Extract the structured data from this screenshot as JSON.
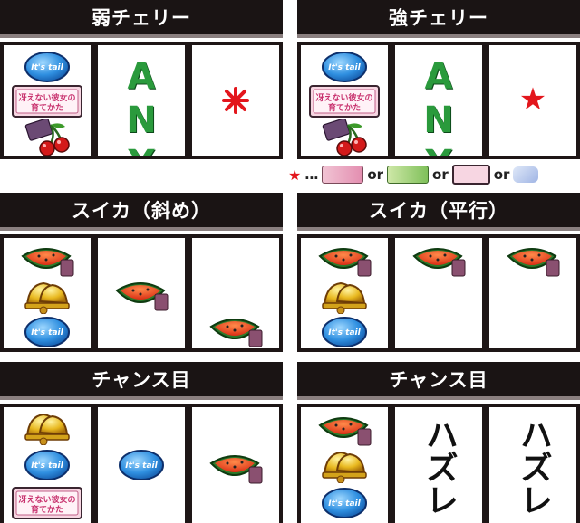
{
  "panels": {
    "weak_cherry": {
      "title": "弱チェリー",
      "any": "ANY"
    },
    "strong_cherry": {
      "title": "強チェリー",
      "any": "ANY"
    },
    "watermelon_diag": {
      "title": "スイカ（斜め）"
    },
    "watermelon_flat": {
      "title": "スイカ（平行）"
    },
    "chance_left": {
      "title": "チャンス目"
    },
    "chance_right": {
      "title": "チャンス目",
      "miss": "ハズレ"
    }
  },
  "legend": {
    "star": "★",
    "ellipsis": "…",
    "or": "or"
  },
  "symbols": {
    "replay_text": "It's tail",
    "logo_line1": "冴えない彼女の",
    "logo_line2": "育てかた"
  },
  "colors": {
    "header_bg": "#1a1414",
    "any_green": "#2a9a3c",
    "star_red": "#e3161c"
  }
}
